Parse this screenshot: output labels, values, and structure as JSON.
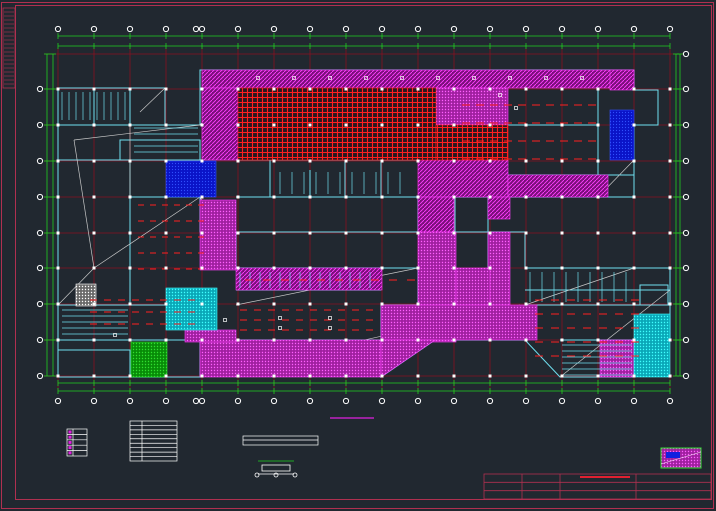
{
  "drawing": {
    "background": "#212830",
    "colors": {
      "frame": "#b03050",
      "axis_line": "#8a1020",
      "dimension": "#20d020",
      "bubble": "#ffffff",
      "wall": "#6fe0f0",
      "column": "#ffffff",
      "magenta_hatch": "#e020e0",
      "red_grid": "#ff2020",
      "blue_fill": "#1020e0",
      "cyan_fill": "#10e0e0",
      "green_fill": "#10c010",
      "gray_line": "#b0b0b0"
    },
    "title_block_rows": 3,
    "schedule_rows": 9,
    "legend_rows": 5
  }
}
